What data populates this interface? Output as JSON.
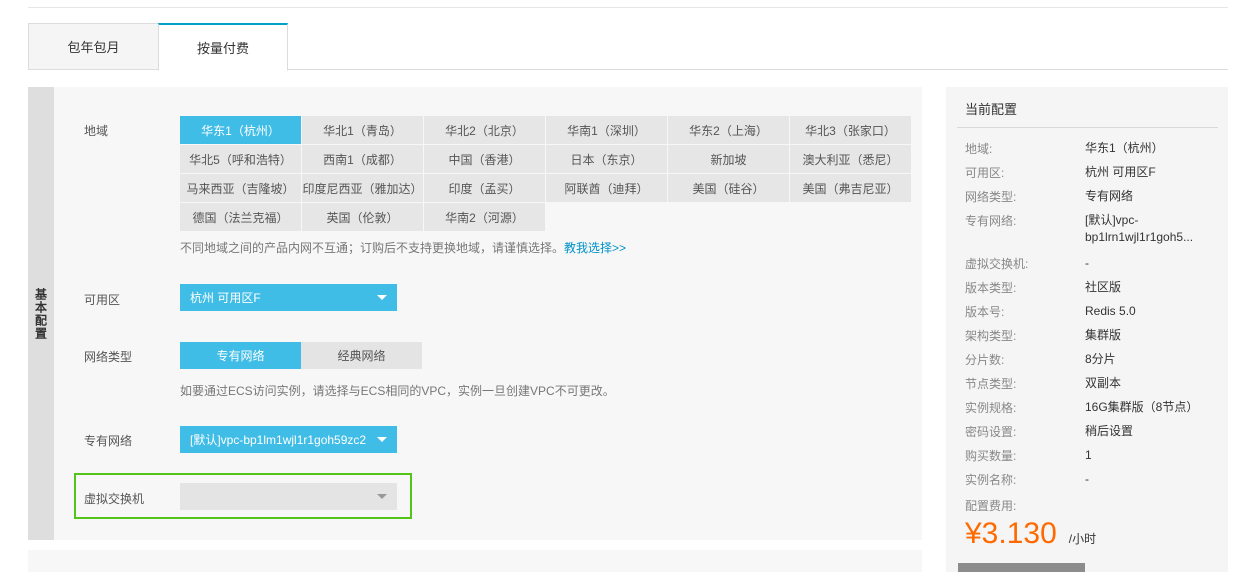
{
  "tabs": [
    {
      "label": "包年包月"
    },
    {
      "label": "按量付费"
    }
  ],
  "section_label": "基本配置",
  "region": {
    "label": "地域",
    "items": [
      "华东1（杭州）",
      "华北1（青岛）",
      "华北2（北京）",
      "华南1（深圳）",
      "华东2（上海）",
      "华北3（张家口）",
      "华北5（呼和浩特）",
      "西南1（成都）",
      "中国（香港）",
      "日本（东京）",
      "新加坡",
      "澳大利亚（悉尼）",
      "马来西亚（吉隆坡）",
      "印度尼西亚（雅加达）",
      "印度（孟买）",
      "阿联酋（迪拜）",
      "美国（硅谷）",
      "美国（弗吉尼亚）",
      "德国（法兰克福）",
      "英国（伦敦）",
      "华南2（河源）"
    ],
    "selected": "华东1（杭州）",
    "hint": "不同地域之间的产品内网不互通；订购后不支持更换地域，请谨慎选择。",
    "hint_link": "教我选择>>"
  },
  "zone": {
    "label": "可用区",
    "value": "杭州 可用区F"
  },
  "network": {
    "label": "网络类型",
    "options": [
      "专有网络",
      "经典网络"
    ],
    "hint": "如要通过ECS访问实例，请选择与ECS相同的VPC，实例一旦创建VPC不可更改。"
  },
  "vpc": {
    "label": "专有网络",
    "value": "[默认]vpc-bp1lm1wjl1r1goh59zc2"
  },
  "vswitch": {
    "label": "虚拟交换机",
    "value": ""
  },
  "summary": {
    "title": "当前配置",
    "rows": [
      {
        "k": "地域:",
        "v": "华东1（杭州）"
      },
      {
        "k": "可用区:",
        "v": "杭州 可用区F"
      },
      {
        "k": "网络类型:",
        "v": "专有网络"
      },
      {
        "k": "专有网络:",
        "v": "[默认]vpc-",
        "v2": "bp1lrn1wjl1r1goh5..."
      },
      {
        "k": "虚拟交换机:",
        "v": "-"
      },
      {
        "k": "版本类型:",
        "v": "社区版"
      },
      {
        "k": "版本号:",
        "v": "Redis 5.0"
      },
      {
        "k": "架构类型:",
        "v": "集群版"
      },
      {
        "k": "分片数:",
        "v": "8分片"
      },
      {
        "k": "节点类型:",
        "v": "双副本"
      },
      {
        "k": "实例规格:",
        "v": "16G集群版（8节点）"
      },
      {
        "k": "密码设置:",
        "v": "稍后设置"
      },
      {
        "k": "购买数量:",
        "v": "1"
      },
      {
        "k": "实例名称:",
        "v": "-"
      },
      {
        "k": "配置费用:",
        "v": ""
      }
    ],
    "price": "¥3.130",
    "price_unit": "/小时"
  },
  "colors": {
    "accent": "#40bde6",
    "price": "#ff6a00",
    "highlight": "#52c41a"
  }
}
